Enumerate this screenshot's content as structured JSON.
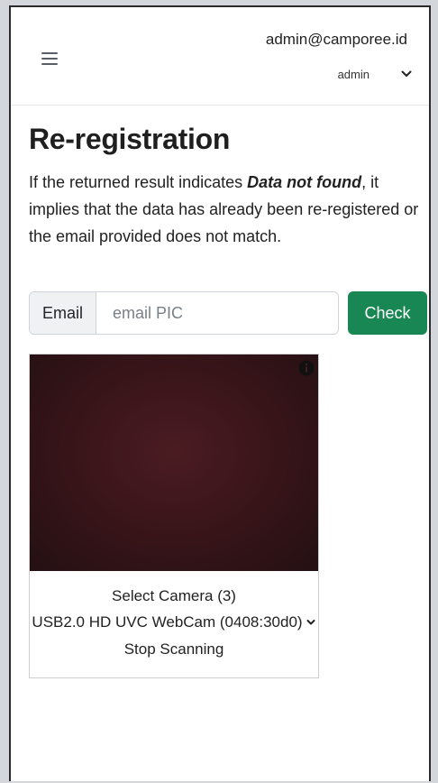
{
  "header": {
    "user_email": "admin@camporee.id",
    "role_selected": "admin"
  },
  "main": {
    "title": "Re-registration",
    "description_before": "If the returned result indicates ",
    "description_emphasis": "Data not found",
    "description_after": ", it implies that the data has already been re-registered or the email provided does not match.",
    "email_label": "Email",
    "email_value": "",
    "email_placeholder": "email PIC",
    "check_label": "Check"
  },
  "scanner": {
    "select_camera_label": "Select Camera (3)",
    "camera_selected": "USB2.0 HD UVC WebCam (0408:30d0)",
    "stop_label": "Stop Scanning"
  },
  "colors": {
    "check_button": "#198754",
    "video_background": "#3a151a"
  },
  "icons": [
    "hamburger-menu-icon",
    "chevron-down-icon",
    "info-icon"
  ]
}
